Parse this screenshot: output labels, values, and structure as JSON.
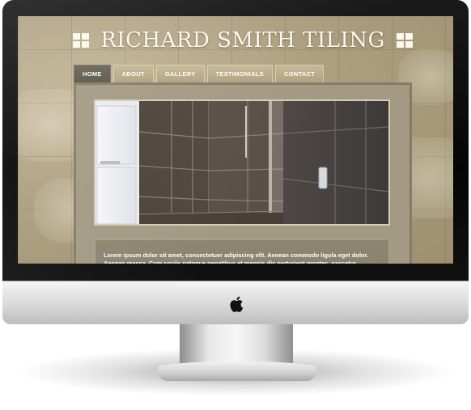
{
  "site": {
    "title": "RICHARD SMITH TILING",
    "colors": {
      "accent": "#fbf8ef",
      "nav_active": "#5f5a4d",
      "nav_inactive": "#b8aa87",
      "panel": "#a39a84"
    }
  },
  "nav": {
    "tabs": [
      {
        "label": "HOME",
        "active": true
      },
      {
        "label": "ABOUT",
        "active": false
      },
      {
        "label": "GALLERY",
        "active": false
      },
      {
        "label": "TESTIMONIALS",
        "active": false
      },
      {
        "label": "CONTACT",
        "active": false
      }
    ]
  },
  "content": {
    "body_text": "Lorem ipsum dolor sit amet, consectetuer adipiscing elit. Aenean commodo ligula eget dolor. Aenean massa. Cum sociis natoque penatibus et magnis dis parturient montes, nascetur ridiculus mus."
  },
  "icons": {
    "header_left": "window-icon",
    "header_right": "window-icon",
    "device_logo": "apple-logo-icon"
  }
}
